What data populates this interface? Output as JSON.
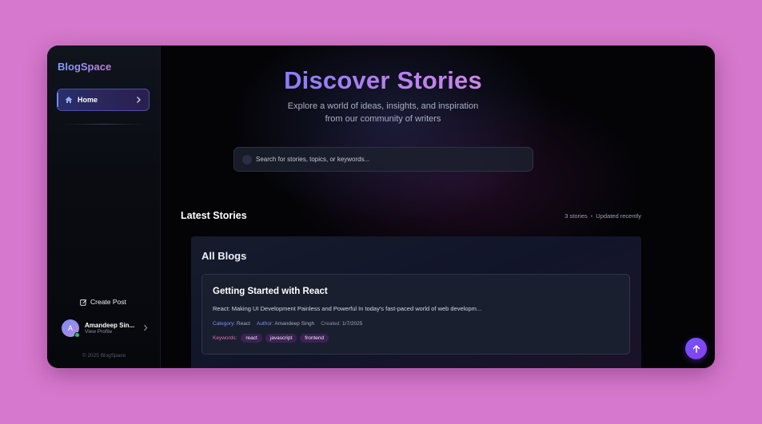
{
  "sidebar": {
    "brand": "BlogSpace",
    "nav": [
      {
        "label": "Home",
        "icon": "home-icon",
        "active": true
      }
    ],
    "create_post": "Create Post",
    "profile": {
      "initial": "A",
      "name": "Amandeep Sin...",
      "subtitle": "View Profile",
      "status": "online"
    },
    "copyright": "© 2025 BlogSpace"
  },
  "hero": {
    "title": "Discover Stories",
    "subtitle": "Explore a world of ideas, insights, and inspiration from our community of writers"
  },
  "search": {
    "placeholder": "Search for stories, topics, or keywords..."
  },
  "latest": {
    "title": "Latest Stories",
    "count": "3 stories",
    "updated": "Updated recently"
  },
  "panel": {
    "title": "All Blogs",
    "posts": [
      {
        "title": "Getting Started with React",
        "excerpt": "React: Making UI Development Painless and Powerful In today's fast-paced world of web developm...",
        "category_label": "Category:",
        "category": "React",
        "author_label": "Author:",
        "author": "Amandeep Singh",
        "created_label": "Created:",
        "created": "1/7/2025",
        "keywords_label": "Keywords:",
        "keywords": [
          "react",
          "javascript",
          "frontend"
        ]
      }
    ]
  },
  "colors": {
    "accent": "#6b8cff",
    "brand_gradient_end": "#c07ce8",
    "page_bg": "#d678cd",
    "keyword_tag_bg": "#3b2252"
  },
  "scroll_top": {
    "icon": "arrow-up-icon"
  }
}
